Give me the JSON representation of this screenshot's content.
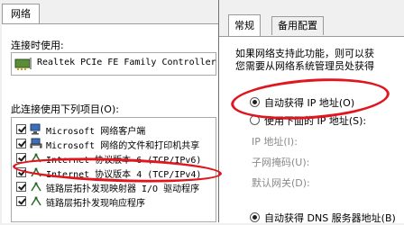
{
  "left_panel": {
    "tab_label": "网络",
    "connect_using_label": "连接时使用:",
    "adapter_name": "Realtek PCIe FE Family Controller",
    "items_label": "此连接使用下列项目(O):",
    "items": [
      {
        "label": "Microsoft 网络客户端",
        "icon": "network-client-icon",
        "checked": true
      },
      {
        "label": "Microsoft 网络的文件和打印机共享",
        "icon": "file-printer-sharing-icon",
        "checked": true
      },
      {
        "label": "Internet 协议版本 6 (TCP/IPv6)",
        "icon": "protocol-icon",
        "checked": true
      },
      {
        "label": "Internet 协议版本 4 (TCP/IPv4)",
        "icon": "protocol-icon",
        "checked": true
      },
      {
        "label": "链路层拓扑发现映射器 I/O 驱动程序",
        "icon": "protocol-icon",
        "checked": true
      },
      {
        "label": "链路层拓扑发现响应程序",
        "icon": "protocol-icon",
        "checked": true
      }
    ]
  },
  "right_panel": {
    "tabs": [
      "常规",
      "备用配置"
    ],
    "active_tab": "常规",
    "description_line1": "如果网络支持此功能，则可以获",
    "description_line2": "您需要从网络系统管理员处获得",
    "auto_ip_label": "自动获得 IP 地址(O)",
    "manual_ip_label": "使用下面的 IP 地址(S):",
    "ip_address_label": "IP 地址(I):",
    "subnet_mask_label": "子网掩码(U):",
    "default_gateway_label": "默认网关(D):",
    "auto_dns_label": "自动获得 DNS 服务器地址(B)"
  },
  "colors": {
    "annotation": "#e0151d",
    "window_bg": "#f0f0f0"
  }
}
